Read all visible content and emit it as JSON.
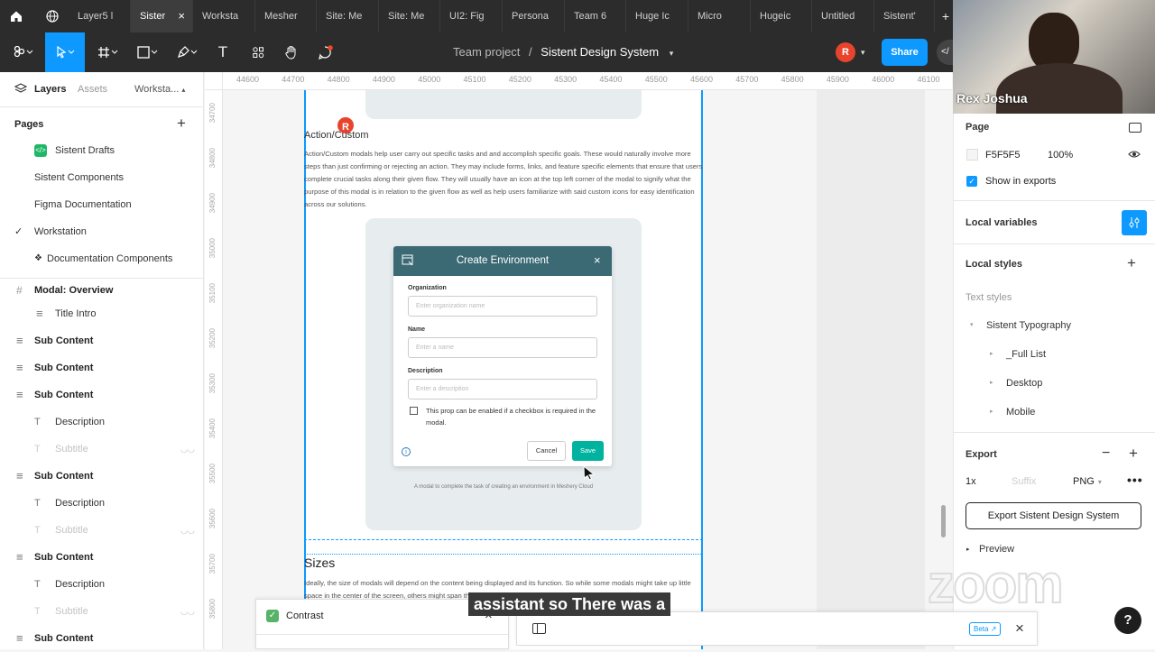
{
  "tabs": [
    "Layer5 l",
    "Sister",
    "Worksta",
    "Mesher",
    "Site: Me",
    "Site: Me",
    "UI2: Fig",
    "Persona",
    "Team 6",
    "Huge Ic",
    "Micro",
    "Hugeic",
    "Untitled",
    "Sistent'"
  ],
  "toolbar": {
    "breadcrumb_team": "Team project",
    "breadcrumb_sep": "/",
    "file_name": "Sistent Design System",
    "avatar_letter": "R",
    "share_label": "Share",
    "code_label": "</"
  },
  "left": {
    "tab_layers": "Layers",
    "tab_assets": "Assets",
    "tab_page": "Workstа...",
    "pages_header": "Pages",
    "pages": [
      "Sistent Drafts",
      "Sistent Components",
      "Figma Documentation",
      "Workstation",
      "Documentation Components"
    ],
    "frame_name": "Modal: Overview",
    "layers": [
      {
        "label": "Title Intro",
        "kind": "text-lines",
        "bold": false,
        "faded": false
      },
      {
        "label": "Sub Content",
        "kind": "lines",
        "bold": true,
        "faded": false
      },
      {
        "label": "Sub Content",
        "kind": "lines",
        "bold": true,
        "faded": false
      },
      {
        "label": "Sub Content",
        "kind": "lines",
        "bold": true,
        "faded": false
      },
      {
        "label": "Description",
        "kind": "text",
        "bold": false,
        "faded": false
      },
      {
        "label": "Subtitle",
        "kind": "text",
        "bold": false,
        "faded": true
      },
      {
        "label": "Sub Content",
        "kind": "lines",
        "bold": true,
        "faded": false
      },
      {
        "label": "Description",
        "kind": "text",
        "bold": false,
        "faded": false
      },
      {
        "label": "Subtitle",
        "kind": "text",
        "bold": false,
        "faded": true
      },
      {
        "label": "Sub Content",
        "kind": "lines",
        "bold": true,
        "faded": false
      },
      {
        "label": "Description",
        "kind": "text",
        "bold": false,
        "faded": false
      },
      {
        "label": "Subtitle",
        "kind": "text",
        "bold": false,
        "faded": true
      },
      {
        "label": "Sub Content",
        "kind": "lines",
        "bold": true,
        "faded": false
      }
    ]
  },
  "ruler_top": [
    "44600",
    "44700",
    "44800",
    "44900",
    "45000",
    "45100",
    "45200",
    "45300",
    "45400",
    "45500",
    "45600",
    "45700",
    "45800",
    "45900",
    "46000",
    "46100"
  ],
  "ruler_left": [
    "34700",
    "34800",
    "34900",
    "35000",
    "35100",
    "35200",
    "35300",
    "35400",
    "35500",
    "35600",
    "35700",
    "35800"
  ],
  "canvas": {
    "cursor_avatar": "R",
    "section_title": "Action/Custom",
    "section_body": "Action/Custom modals help user carry out specific tasks and and accomplish specific goals. These would naturally involve more steps than just confirming or rejecting an action. They may include forms, links, and feature specific elements that ensure that users complete crucial tasks along their given flow. They will usually have an icon at the top left corner of the modal to signify what the purpose of this modal is in relation to the given flow as well as help users familiarize with said custom icons for easy identification across our solutions.",
    "modal": {
      "title": "Create Environment",
      "close": "×",
      "org_label": "Organization",
      "org_placeholder": "Enter organization name",
      "name_label": "Name",
      "name_placeholder": "Enter a name",
      "desc_label": "Description",
      "desc_placeholder": "Enter a description",
      "checkbox_text": "This prop can be enabled if a checkbox is required in the modal.",
      "cancel": "Cancel",
      "save": "Save"
    },
    "caption": "A modal to complete the task of creating an environment in Meshery Cloud",
    "sizes_title": "Sizes",
    "sizes_body": "Ideally, the size of modals will depend on the content being displayed and its function. So while some modals might take up little space in the center of the screen, others might span the entire viewport width."
  },
  "video": {
    "name": "Rex Joshua"
  },
  "right": {
    "page_header": "Page",
    "bg_hex": "F5F5F5",
    "bg_opacity": "100%",
    "show_exports": "Show in exports",
    "local_variables": "Local variables",
    "local_styles": "Local styles",
    "text_styles": "Text styles",
    "typography": "Sistent Typography",
    "styles": [
      "_Full List",
      "Desktop",
      "Mobile"
    ],
    "export_header": "Export",
    "export_scale": "1x",
    "export_suffix": "Suffix",
    "export_format": "PNG",
    "export_button": "Export Sistent Design System",
    "preview": "Preview"
  },
  "bottom": {
    "contrast_label": "Contrast",
    "beta": "Beta",
    "subtitle": "assistant so There was a",
    "zoom_watermark": "zoom",
    "help": "?"
  }
}
